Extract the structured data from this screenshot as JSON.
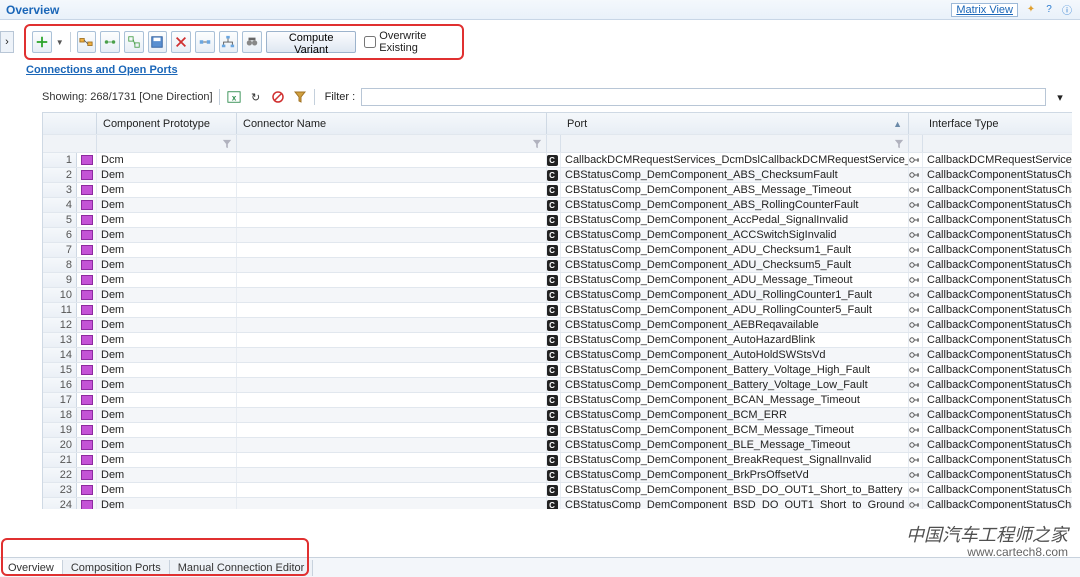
{
  "header": {
    "title": "Overview",
    "matrix_view": "Matrix View"
  },
  "toolbar": {
    "compute_variant": "Compute Variant",
    "overwrite_existing": "Overwrite Existing"
  },
  "section_title": "Connections and Open Ports",
  "filterbar": {
    "showing": "Showing: 268/1731 [One Direction]",
    "filter_label": "Filter :",
    "filter_value": ""
  },
  "columns": {
    "component": "Component Prototype",
    "connector": "Connector Name",
    "port": "Port",
    "interface": "Interface Type"
  },
  "rows": [
    {
      "n": 1,
      "comp": "Dcm",
      "conn": "",
      "port": "CallbackDCMRequestServices_DcmDslCallbackDCMRequestService_Safety",
      "iface": "CallbackDCMRequestServices"
    },
    {
      "n": 2,
      "comp": "Dem",
      "conn": "",
      "port": "CBStatusComp_DemComponent_ABS_ChecksumFault",
      "iface": "CallbackComponentStatusChanged"
    },
    {
      "n": 3,
      "comp": "Dem",
      "conn": "",
      "port": "CBStatusComp_DemComponent_ABS_Message_Timeout",
      "iface": "CallbackComponentStatusChanged"
    },
    {
      "n": 4,
      "comp": "Dem",
      "conn": "",
      "port": "CBStatusComp_DemComponent_ABS_RollingCounterFault",
      "iface": "CallbackComponentStatusChanged"
    },
    {
      "n": 5,
      "comp": "Dem",
      "conn": "",
      "port": "CBStatusComp_DemComponent_AccPedal_SignalInvalid",
      "iface": "CallbackComponentStatusChanged"
    },
    {
      "n": 6,
      "comp": "Dem",
      "conn": "",
      "port": "CBStatusComp_DemComponent_ACCSwitchSigInvalid",
      "iface": "CallbackComponentStatusChanged"
    },
    {
      "n": 7,
      "comp": "Dem",
      "conn": "",
      "port": "CBStatusComp_DemComponent_ADU_Checksum1_Fault",
      "iface": "CallbackComponentStatusChanged"
    },
    {
      "n": 8,
      "comp": "Dem",
      "conn": "",
      "port": "CBStatusComp_DemComponent_ADU_Checksum5_Fault",
      "iface": "CallbackComponentStatusChanged"
    },
    {
      "n": 9,
      "comp": "Dem",
      "conn": "",
      "port": "CBStatusComp_DemComponent_ADU_Message_Timeout",
      "iface": "CallbackComponentStatusChanged"
    },
    {
      "n": 10,
      "comp": "Dem",
      "conn": "",
      "port": "CBStatusComp_DemComponent_ADU_RollingCounter1_Fault",
      "iface": "CallbackComponentStatusChanged"
    },
    {
      "n": 11,
      "comp": "Dem",
      "conn": "",
      "port": "CBStatusComp_DemComponent_ADU_RollingCounter5_Fault",
      "iface": "CallbackComponentStatusChanged"
    },
    {
      "n": 12,
      "comp": "Dem",
      "conn": "",
      "port": "CBStatusComp_DemComponent_AEBReqavailable",
      "iface": "CallbackComponentStatusChanged"
    },
    {
      "n": 13,
      "comp": "Dem",
      "conn": "",
      "port": "CBStatusComp_DemComponent_AutoHazardBlink",
      "iface": "CallbackComponentStatusChanged"
    },
    {
      "n": 14,
      "comp": "Dem",
      "conn": "",
      "port": "CBStatusComp_DemComponent_AutoHoldSWStsVd",
      "iface": "CallbackComponentStatusChanged"
    },
    {
      "n": 15,
      "comp": "Dem",
      "conn": "",
      "port": "CBStatusComp_DemComponent_Battery_Voltage_High_Fault",
      "iface": "CallbackComponentStatusChanged"
    },
    {
      "n": 16,
      "comp": "Dem",
      "conn": "",
      "port": "CBStatusComp_DemComponent_Battery_Voltage_Low_Fault",
      "iface": "CallbackComponentStatusChanged"
    },
    {
      "n": 17,
      "comp": "Dem",
      "conn": "",
      "port": "CBStatusComp_DemComponent_BCAN_Message_Timeout",
      "iface": "CallbackComponentStatusChanged"
    },
    {
      "n": 18,
      "comp": "Dem",
      "conn": "",
      "port": "CBStatusComp_DemComponent_BCM_ERR",
      "iface": "CallbackComponentStatusChanged"
    },
    {
      "n": 19,
      "comp": "Dem",
      "conn": "",
      "port": "CBStatusComp_DemComponent_BCM_Message_Timeout",
      "iface": "CallbackComponentStatusChanged"
    },
    {
      "n": 20,
      "comp": "Dem",
      "conn": "",
      "port": "CBStatusComp_DemComponent_BLE_Message_Timeout",
      "iface": "CallbackComponentStatusChanged"
    },
    {
      "n": 21,
      "comp": "Dem",
      "conn": "",
      "port": "CBStatusComp_DemComponent_BreakRequest_SignalInvalid",
      "iface": "CallbackComponentStatusChanged"
    },
    {
      "n": 22,
      "comp": "Dem",
      "conn": "",
      "port": "CBStatusComp_DemComponent_BrkPrsOffsetVd",
      "iface": "CallbackComponentStatusChanged"
    },
    {
      "n": 23,
      "comp": "Dem",
      "conn": "",
      "port": "CBStatusComp_DemComponent_BSD_DO_OUT1_Short_to_Battery",
      "iface": "CallbackComponentStatusChanged"
    },
    {
      "n": 24,
      "comp": "Dem",
      "conn": "",
      "port": "CBStatusComp_DemComponent_BSD_DO_OUT1_Short_to_Ground",
      "iface": "CallbackComponentStatusChanged"
    }
  ],
  "tabs": {
    "overview": "Overview",
    "composition_ports": "Composition Ports",
    "manual_connection_editor": "Manual Connection Editor"
  },
  "watermark": {
    "line1": "中国汽车工程师之家",
    "line2": "www.cartech8.com"
  }
}
